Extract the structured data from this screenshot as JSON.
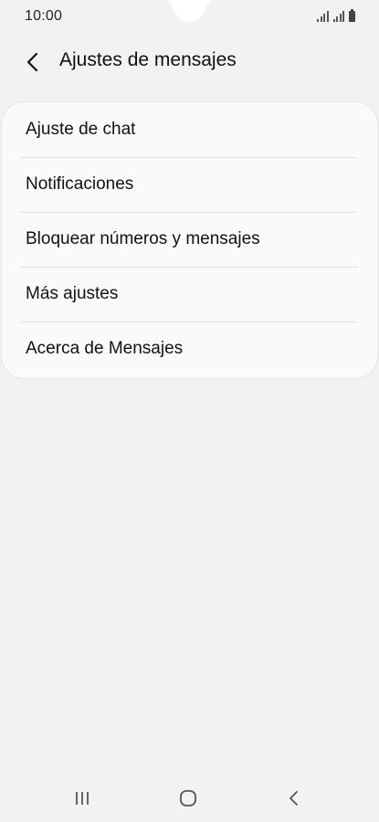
{
  "status_bar": {
    "time": "10:00",
    "icons": [
      "signal-icon",
      "signal-icon",
      "battery-icon"
    ]
  },
  "header": {
    "back_icon": "back-arrow-icon",
    "title": "Ajustes de mensajes"
  },
  "settings": {
    "items": [
      {
        "label": "Ajuste de chat"
      },
      {
        "label": "Notificaciones"
      },
      {
        "label": "Bloquear números y mensajes"
      },
      {
        "label": "Más ajustes"
      },
      {
        "label": "Acerca de Mensajes"
      }
    ]
  },
  "navigation_bar": {
    "icons": [
      "recent-apps-icon",
      "home-icon",
      "back-icon"
    ]
  },
  "colors": {
    "background": "#f2f2f2",
    "card": "#fafafa",
    "divider": "#e2e2e2",
    "text": "#111111"
  }
}
